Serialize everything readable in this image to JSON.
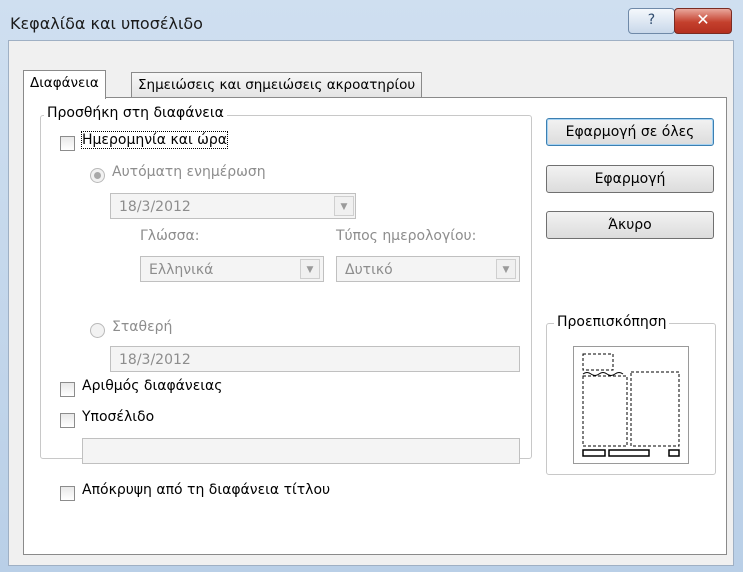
{
  "window": {
    "title": "Κεφαλίδα και υποσέλιδο",
    "help_label": "?",
    "close_label": "✕"
  },
  "tabs": [
    {
      "label": "Διαφάνεια",
      "active": true
    },
    {
      "label": "Σημειώσεις και σημειώσεις ακροατηρίου",
      "active": false
    }
  ],
  "group": {
    "label": "Προσθήκη στη διαφάνεια"
  },
  "datetime": {
    "checkbox_label": "Ημερομηνία και ώρα",
    "checked": false,
    "auto_label": "Αυτόματη ενημέρωση",
    "auto_selected": true,
    "auto_value": "18/3/2012",
    "language_label": "Γλώσσα:",
    "language_value": "Ελληνικά",
    "calendar_label": "Τύπος ημερολογίου:",
    "calendar_value": "Δυτικό",
    "fixed_label": "Σταθερή",
    "fixed_value": "18/3/2012"
  },
  "slide_number": {
    "label": "Αριθμός διαφάνειας",
    "checked": false
  },
  "footer": {
    "label": "Υποσέλιδο",
    "checked": false,
    "value": ""
  },
  "hide_title": {
    "label": "Απόκρυψη από τη διαφάνεια τίτλου",
    "checked": false
  },
  "buttons": {
    "apply_all": "Εφαρμογή σε όλες",
    "apply": "Εφαρμογή",
    "cancel": "Άκυρο"
  },
  "preview": {
    "label": "Προεπισκόπηση"
  },
  "icons": {
    "dropdown": "chevron-down-icon",
    "help": "question-icon",
    "close": "close-icon"
  },
  "colors": {
    "close_red": "#c4402d",
    "default_button_border": "#3c7fb1",
    "disabled_text": "#8d8d8d"
  }
}
